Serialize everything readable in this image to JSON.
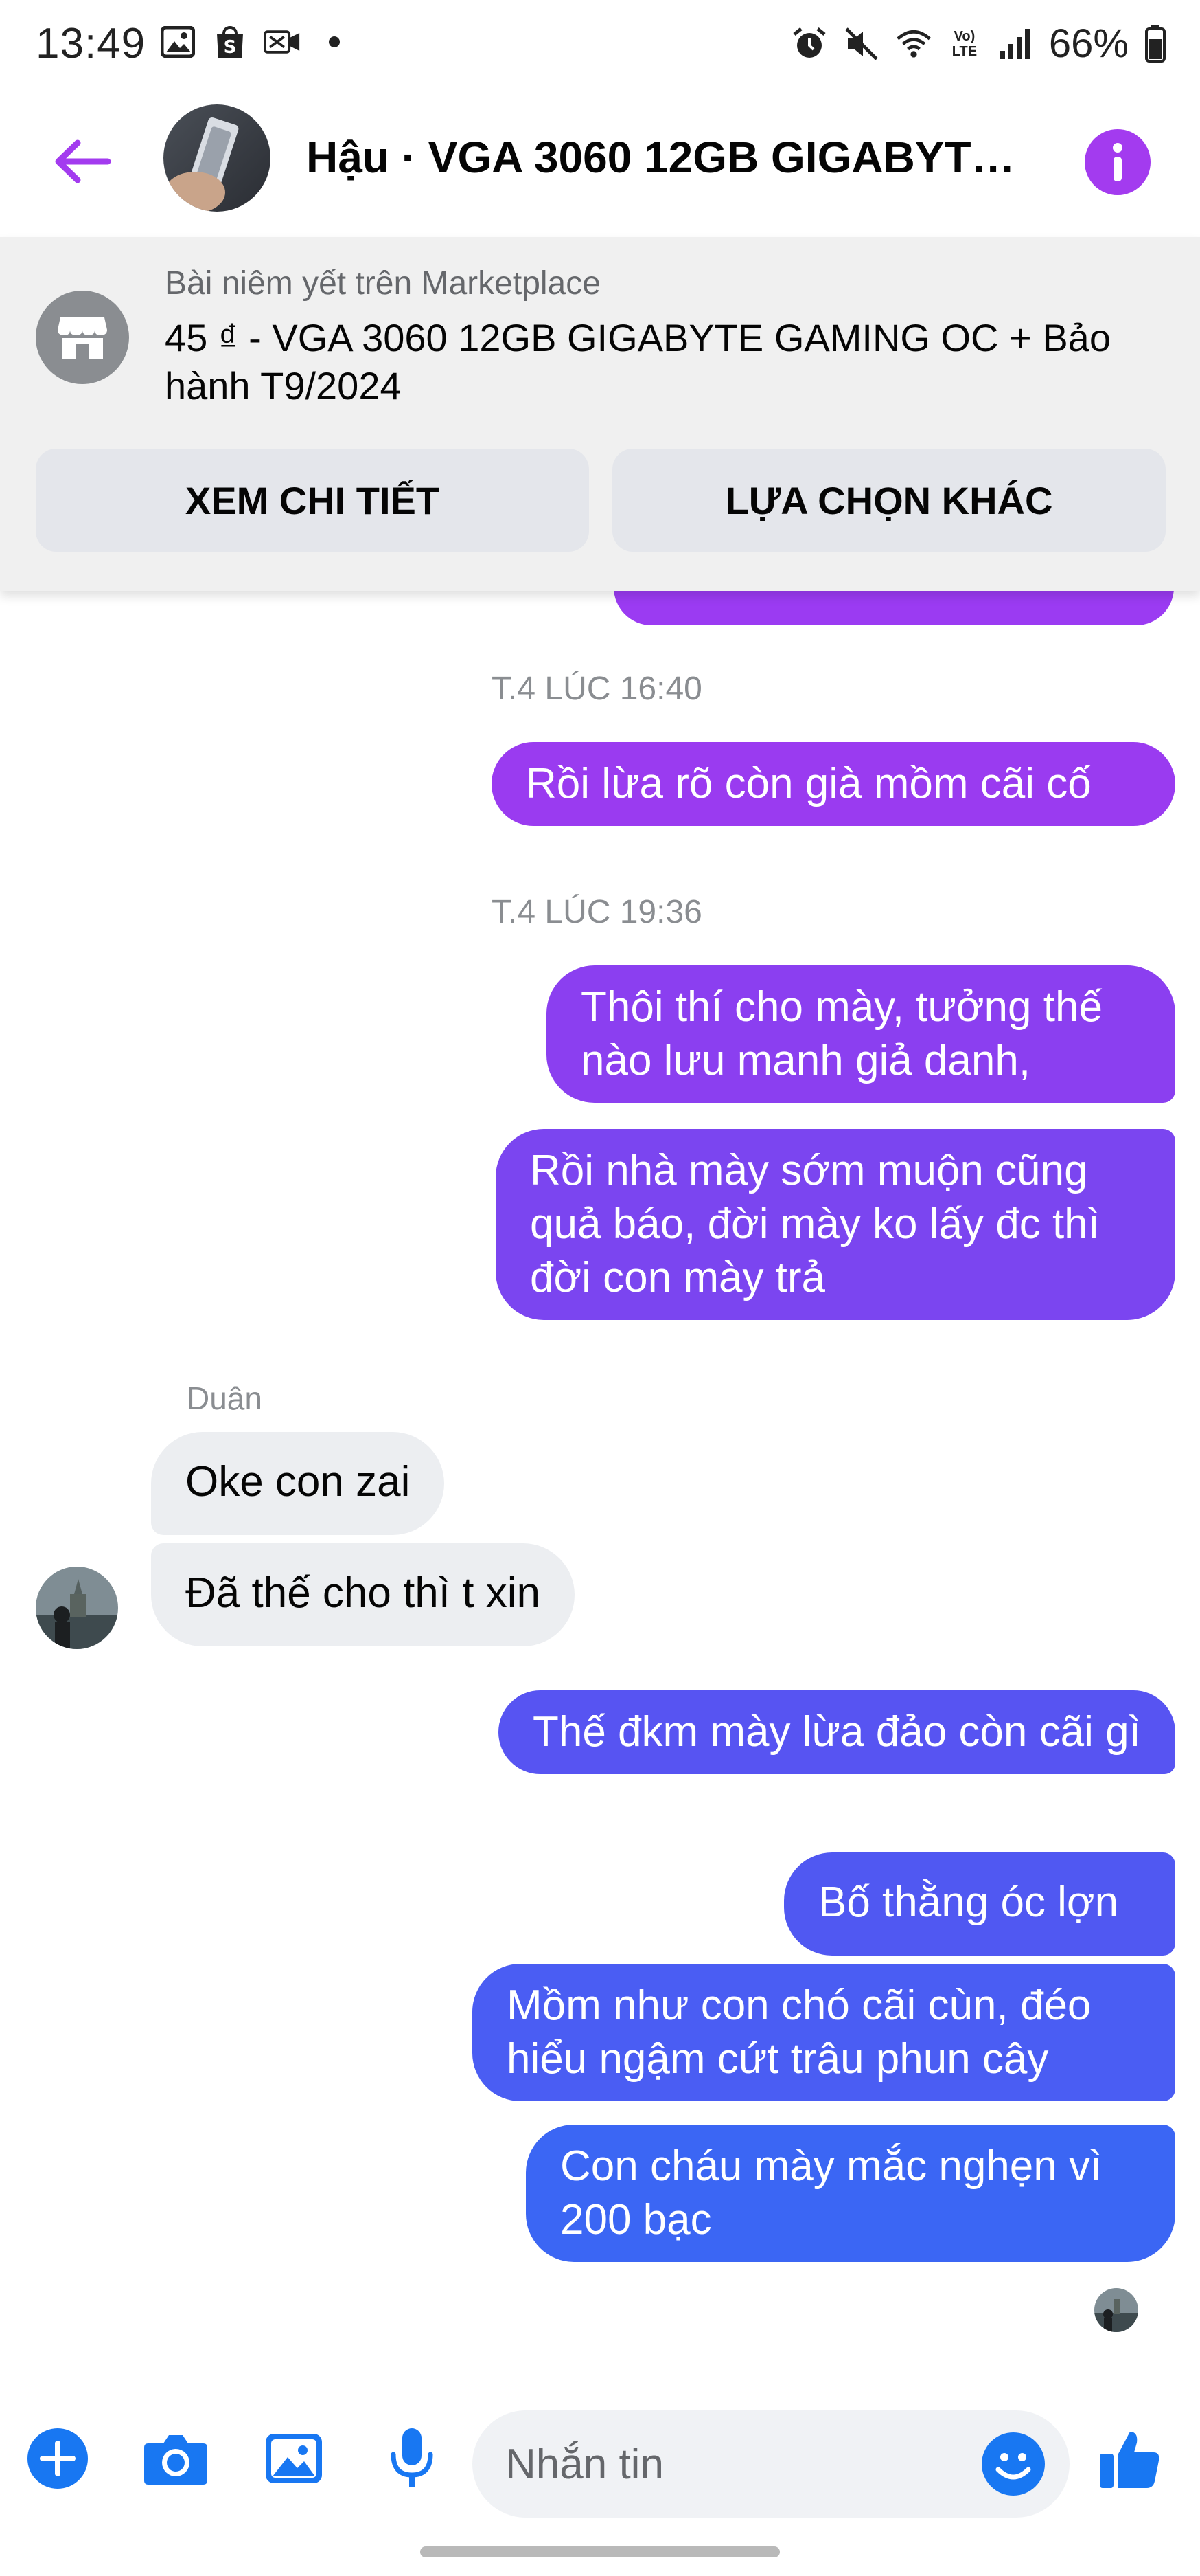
{
  "status_bar": {
    "time": "13:49",
    "left_icons": [
      "image-icon",
      "shopee-icon",
      "vpn-icon",
      "dot-icon"
    ],
    "right_icons": [
      "alarm-icon",
      "mute-icon",
      "wifi-icon",
      "volte-icon",
      "signal-icon",
      "battery-icon"
    ],
    "volte_label": "Vo) LTE",
    "battery": "66%"
  },
  "header": {
    "title": "Hậu · VGA 3060 12GB GIGABYTE GAMING OC + Bảo hành T9/2024",
    "accent_color": "#a33bef"
  },
  "banner": {
    "label": "Bài niêm yết trên Marketplace",
    "title": "45 ₫ - VGA 3060 12GB GIGABYTE GAMING OC + Bảo hành T9/2024",
    "btn_details": "XEM CHI TIẾT",
    "btn_other": "LỰA CHỌN KHÁC"
  },
  "chat": {
    "timestamp_1": "T.4 LÚC 16:40",
    "timestamp_2": "T.4 LÚC 19:36",
    "msg_1": "Rồi lừa rõ còn già mồm cãi cố",
    "msg_2": "Thôi thí cho mày, tưởng thế nào  lưu manh giả danh,",
    "msg_3": "Rồi nhà mày sớm muộn cũng quả báo, đời mày ko lấy đc thì đời con mày trả",
    "sender_name": "Duân",
    "in_msg_1": "Oke con zai",
    "in_msg_2": "Đã thế cho thì t xin",
    "msg_4": "Thế đkm mày lừa đảo còn cãi gì",
    "msg_5": "Bố thằng óc lợn",
    "msg_6": "Mồm như con chó cãi cùn, đéo hiểu ngậm cứt trâu phun cây",
    "msg_7": "Con cháu mày mắc nghẹn vì 200 bạc"
  },
  "composer": {
    "placeholder": "Nhắn tin",
    "icons": [
      "plus-icon",
      "camera-icon",
      "gallery-icon",
      "microphone-icon",
      "emoji-icon",
      "like-icon"
    ]
  }
}
